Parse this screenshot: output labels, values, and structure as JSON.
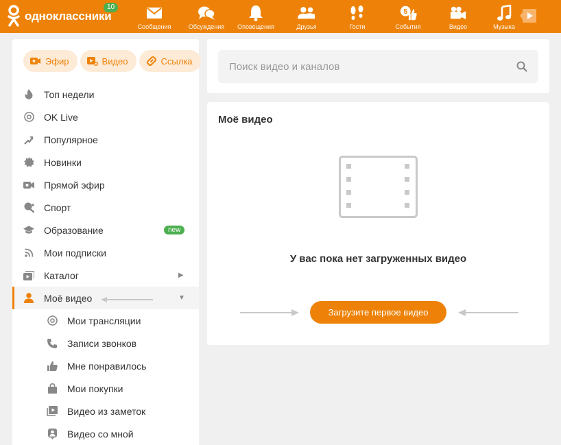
{
  "header": {
    "logo_text": "одноклассники",
    "badge": "10",
    "nav": [
      {
        "label": "Сообщения",
        "icon": "envelope-icon"
      },
      {
        "label": "Обсуждения",
        "icon": "chat-bubbles-icon"
      },
      {
        "label": "Оповещения",
        "icon": "bell-icon"
      },
      {
        "label": "Друзья",
        "icon": "friends-icon"
      },
      {
        "label": "Гости",
        "icon": "footprints-icon"
      },
      {
        "label": "События",
        "icon": "like-events-icon",
        "count": "5"
      },
      {
        "label": "Видео",
        "icon": "video-camera-icon"
      },
      {
        "label": "Музыка",
        "icon": "music-note-icon"
      }
    ]
  },
  "sidebar": {
    "chips": [
      {
        "label": "Эфир",
        "icon": "live-broadcast-icon"
      },
      {
        "label": "Видео",
        "icon": "add-video-icon"
      },
      {
        "label": "Ссылка",
        "icon": "link-icon"
      }
    ],
    "items": [
      {
        "label": "Топ недели",
        "icon": "flame-icon"
      },
      {
        "label": "OK Live",
        "icon": "ok-live-icon"
      },
      {
        "label": "Популярное",
        "icon": "trending-arrow-icon"
      },
      {
        "label": "Новинки",
        "icon": "new-badge-icon"
      },
      {
        "label": "Прямой эфир",
        "icon": "live-camera-icon"
      },
      {
        "label": "Спорт",
        "icon": "sport-icon"
      },
      {
        "label": "Образование",
        "icon": "graduation-cap-icon",
        "badge": "new"
      },
      {
        "label": "Мои подписки",
        "icon": "rss-icon"
      },
      {
        "label": "Каталог",
        "icon": "catalog-icon"
      },
      {
        "label": "Моё видео",
        "icon": "user-icon"
      }
    ],
    "sub_items": [
      {
        "label": "Мои трансляции",
        "icon": "broadcast-icon"
      },
      {
        "label": "Записи звонков",
        "icon": "phone-icon"
      },
      {
        "label": "Мне понравилось",
        "icon": "thumbs-up-icon"
      },
      {
        "label": "Мои покупки",
        "icon": "shopping-bag-icon"
      },
      {
        "label": "Видео из заметок",
        "icon": "notes-video-icon"
      },
      {
        "label": "Видео со мной",
        "icon": "person-tag-icon"
      }
    ]
  },
  "search": {
    "placeholder": "Поиск видео и каналов"
  },
  "main": {
    "title": "Моё видео",
    "empty_text": "У вас пока нет загруженных видео",
    "upload_label": "Загрузите первое видео"
  },
  "colors": {
    "accent": "#ee8208",
    "green": "#4caf50",
    "panel": "#ffffff",
    "bg": "#f0f0f0"
  }
}
